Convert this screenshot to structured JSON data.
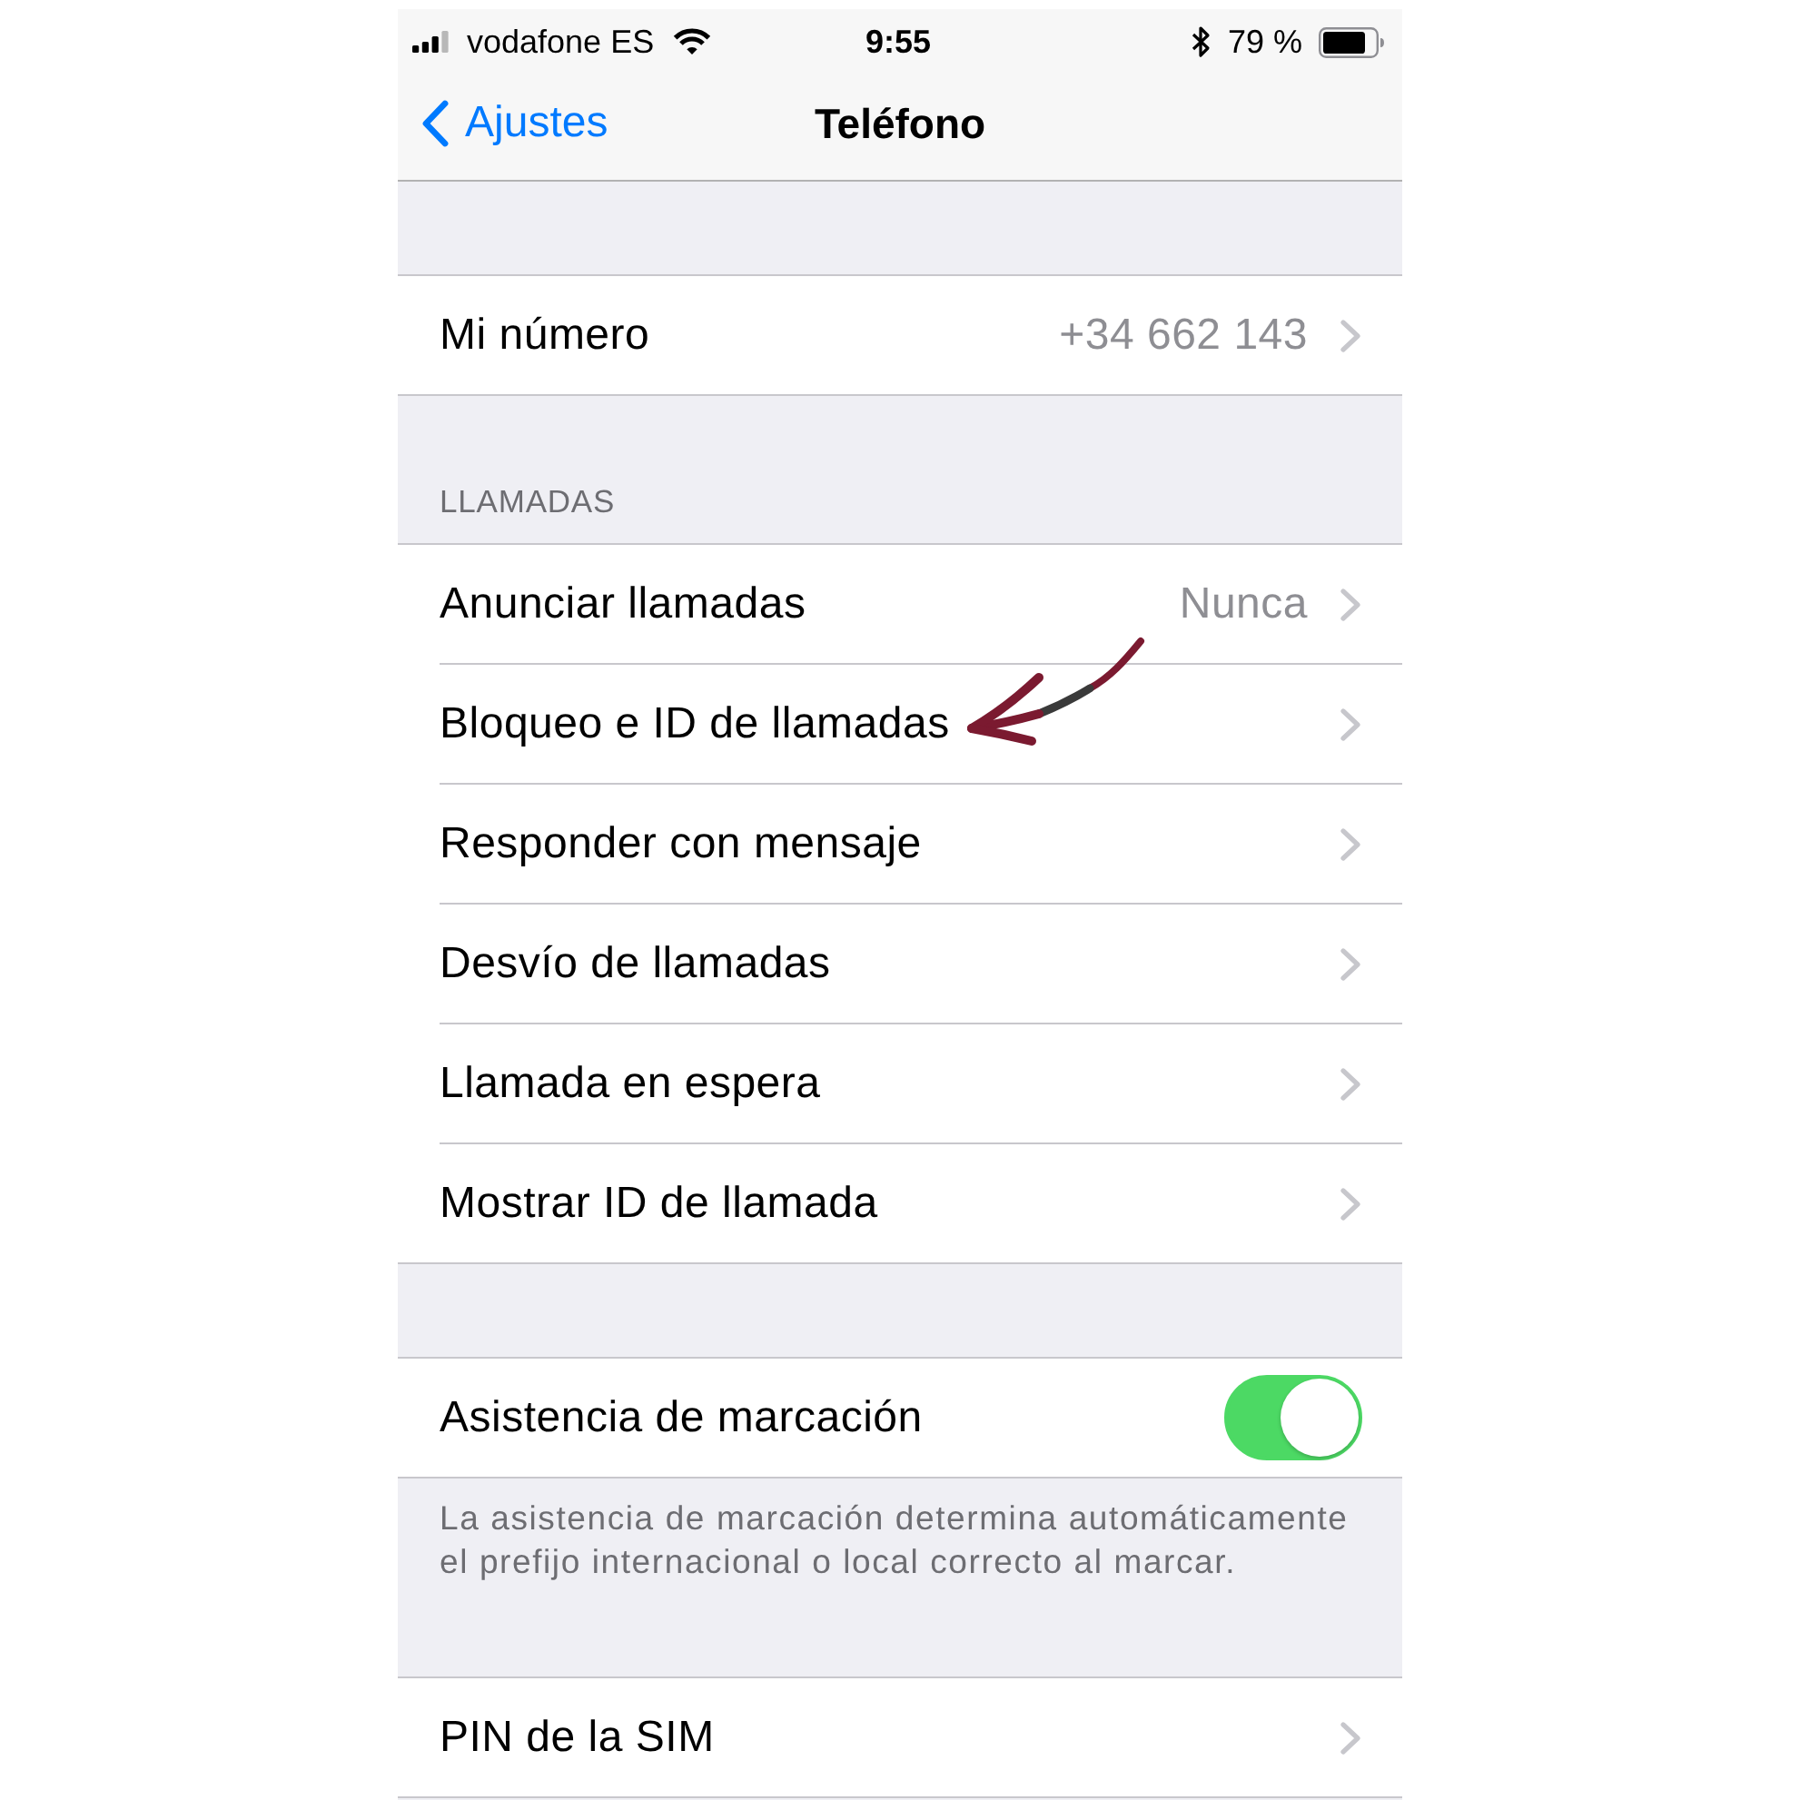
{
  "status_bar": {
    "carrier": "vodafone ES",
    "time": "9:55",
    "battery": "79 %"
  },
  "nav_bar": {
    "back": "Ajustes",
    "title": "Teléfono"
  },
  "groups": [
    {
      "rows": [
        {
          "kind": "link",
          "label": "Mi número",
          "value": "+34 662 143",
          "annotated": false
        }
      ]
    },
    {
      "header": "LLAMADAS",
      "rows": [
        {
          "kind": "link",
          "label": "Anunciar llamadas",
          "value": "Nunca",
          "annotated": false
        },
        {
          "kind": "link",
          "label": "Bloqueo e ID de llamadas",
          "annotated": true
        },
        {
          "kind": "link",
          "label": "Responder con mensaje",
          "annotated": false
        },
        {
          "kind": "link",
          "label": "Desvío de llamadas",
          "annotated": false
        },
        {
          "kind": "link",
          "label": "Llamada en espera",
          "annotated": false
        },
        {
          "kind": "link",
          "label": "Mostrar ID de llamada",
          "annotated": false
        }
      ]
    },
    {
      "rows": [
        {
          "kind": "toggle",
          "label": "Asistencia de marcación",
          "on": true,
          "annotated": false
        }
      ],
      "footer": "La asistencia de marcación determina automáticamente el prefijo internacional o local correcto al marcar."
    },
    {
      "rows": [
        {
          "kind": "link",
          "label": "PIN de la SIM",
          "annotated": false
        }
      ]
    }
  ]
}
